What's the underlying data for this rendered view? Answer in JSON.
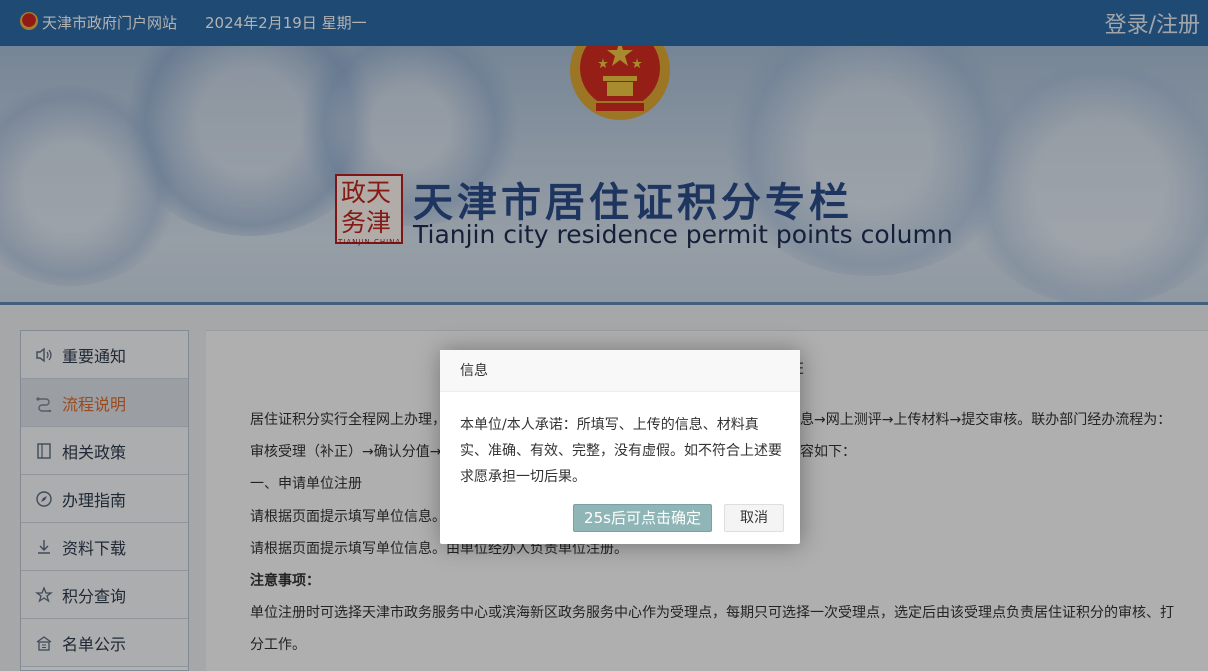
{
  "topbar": {
    "site_name": "天津市政府门户网站",
    "date": "2024年2月19日 星期一",
    "login_label": "登录/注册"
  },
  "banner": {
    "title": "天津市居住证积分专栏",
    "subtitle": "Tianjin city residence permit points column",
    "seal_line1": "政天",
    "seal_line2": "务津",
    "seal_caption": "TIANJIN CHINA"
  },
  "sidebar": {
    "items": [
      {
        "label": "重要通知",
        "icon": "speaker-icon"
      },
      {
        "label": "流程说明",
        "icon": "flow-icon"
      },
      {
        "label": "相关政策",
        "icon": "document-icon"
      },
      {
        "label": "办理指南",
        "icon": "compass-icon"
      },
      {
        "label": "资料下载",
        "icon": "download-icon"
      },
      {
        "label": "积分查询",
        "icon": "star-icon"
      },
      {
        "label": "名单公示",
        "icon": "building-icon"
      }
    ],
    "active_index": 1
  },
  "content": {
    "partial_title": "E",
    "lines": [
      "居住证积分实行全程网上办理，",
      "审核受理（补正）→确认分值→",
      "一、申请单位注册",
      "请根据页面提示填写单位信息。",
      "请根据页面提示填写单位信息。由单位经办人负责单位注册。",
      "注意事项：",
      "单位注册时可选择天津市政务服务中心或滨海新区政务服务中心作为受理点，每期只可选择一次受理点，选定后由该受理点负责居住证积分的审核、打",
      "分工作。"
    ],
    "right_frag1": "息→网上测评→上传材料→提交审核。联办部门经办流程为：",
    "right_frag2": "容如下："
  },
  "dialog": {
    "title": "信息",
    "body": "本单位/本人承诺：所填写、上传的信息、材料真实、准确、有效、完整，没有虚假。如不符合上述要求愿承担一切后果。",
    "ok_label": "25s后可点击确定",
    "cancel_label": "取消"
  },
  "colors": {
    "topbar": "#2c6aa5",
    "active_nav": "#de6a2c",
    "ok_button": "#8fb5b6"
  }
}
